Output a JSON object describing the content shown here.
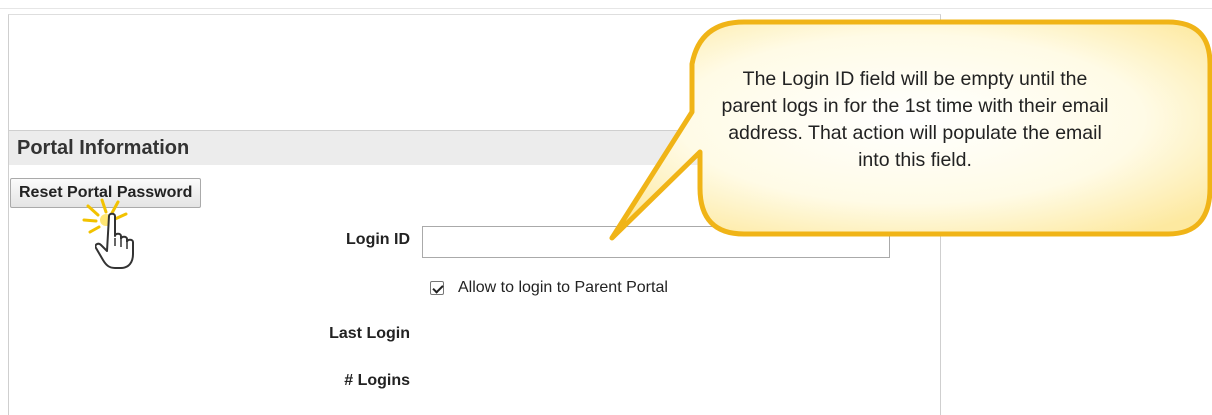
{
  "section": {
    "title": "Portal Information"
  },
  "buttons": {
    "reset_portal_password": "Reset Portal Password"
  },
  "fields": {
    "login_id_label": "Login ID",
    "login_id_value": "",
    "allow_login_label": "Allow to login to Parent Portal",
    "allow_login_checked": true,
    "last_login_label": "Last Login",
    "logins_label": "# Logins"
  },
  "callout": {
    "text": "The Login ID field will be empty until the parent logs in for the 1st time with their email address. That action will populate the email into this field.",
    "fill_color": "#fff8d6",
    "border_color": "#f0b417"
  },
  "icons": {
    "cursor": "hand-pointer-icon",
    "click_burst": "click-burst-icon"
  }
}
